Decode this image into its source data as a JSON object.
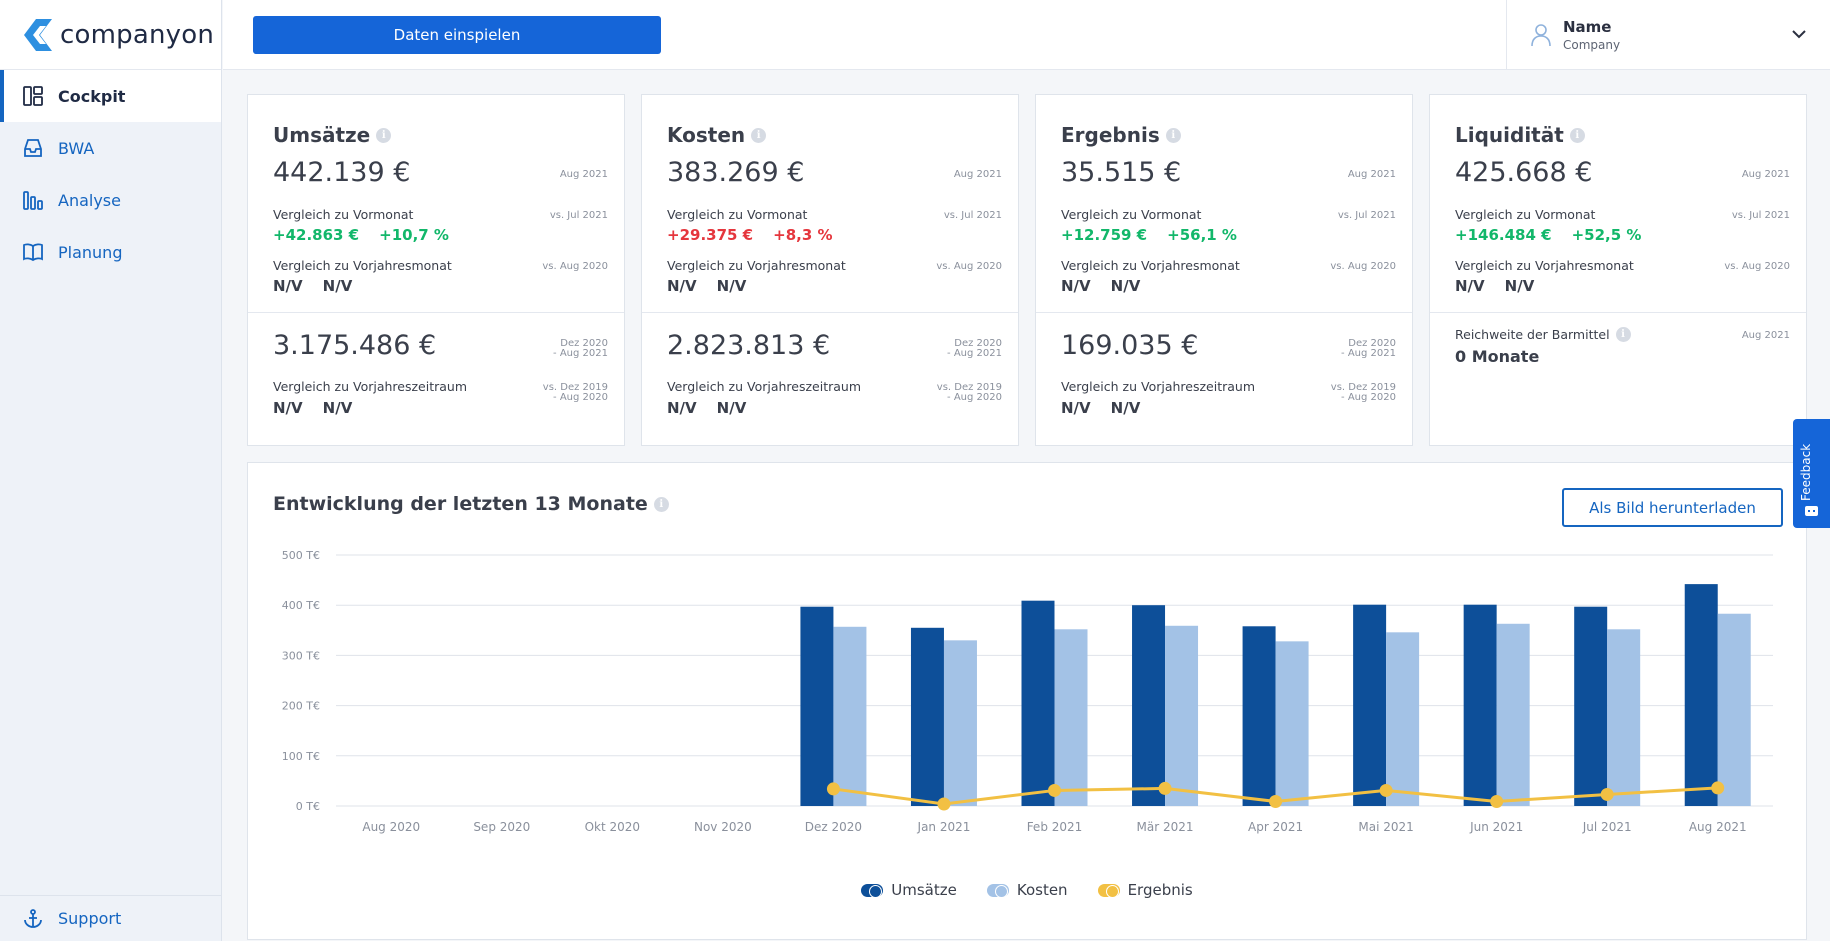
{
  "app": {
    "logo_text": "companyon"
  },
  "sidebar": {
    "items": [
      {
        "label": "Cockpit",
        "icon": "dashboard-icon",
        "active": true
      },
      {
        "label": "BWA",
        "icon": "inbox-icon",
        "active": false
      },
      {
        "label": "Analyse",
        "icon": "bar-chart-icon",
        "active": false
      },
      {
        "label": "Planung",
        "icon": "book-icon",
        "active": false
      }
    ],
    "support_label": "Support"
  },
  "topbar": {
    "import_button": "Daten einspielen",
    "user_name": "Name",
    "user_company": "Company"
  },
  "cards": [
    {
      "title": "Umsätze",
      "value": "442.139 €",
      "date": "Aug 2021",
      "vm_label": "Vergleich zu Vormonat",
      "vm_date": "vs. Jul 2021",
      "vm_abs": "+42.863 €",
      "vm_pct": "+10,7 %",
      "vm_status": "pos",
      "vj_label": "Vergleich zu Vorjahresmonat",
      "vj_date": "vs. Aug 2020",
      "vj_abs": "N/V",
      "vj_pct": "N/V",
      "range_value": "3.175.486 €",
      "range_date1": "Dez 2020",
      "range_date2": "- Aug 2021",
      "vz_label": "Vergleich zu Vorjahreszeitraum",
      "vz_date1": "vs. Dez 2019",
      "vz_date2": "- Aug 2020",
      "vz_abs": "N/V",
      "vz_pct": "N/V"
    },
    {
      "title": "Kosten",
      "value": "383.269 €",
      "date": "Aug 2021",
      "vm_label": "Vergleich zu Vormonat",
      "vm_date": "vs. Jul 2021",
      "vm_abs": "+29.375 €",
      "vm_pct": "+8,3 %",
      "vm_status": "neg",
      "vj_label": "Vergleich zu Vorjahresmonat",
      "vj_date": "vs. Aug 2020",
      "vj_abs": "N/V",
      "vj_pct": "N/V",
      "range_value": "2.823.813 €",
      "range_date1": "Dez 2020",
      "range_date2": "- Aug 2021",
      "vz_label": "Vergleich zu Vorjahreszeitraum",
      "vz_date1": "vs. Dez 2019",
      "vz_date2": "- Aug 2020",
      "vz_abs": "N/V",
      "vz_pct": "N/V"
    },
    {
      "title": "Ergebnis",
      "value": "35.515 €",
      "date": "Aug 2021",
      "vm_label": "Vergleich zu Vormonat",
      "vm_date": "vs. Jul 2021",
      "vm_abs": "+12.759 €",
      "vm_pct": "+56,1 %",
      "vm_status": "pos",
      "vj_label": "Vergleich zu Vorjahresmonat",
      "vj_date": "vs. Aug 2020",
      "vj_abs": "N/V",
      "vj_pct": "N/V",
      "range_value": "169.035 €",
      "range_date1": "Dez 2020",
      "range_date2": "- Aug 2021",
      "vz_label": "Vergleich zu Vorjahreszeitraum",
      "vz_date1": "vs. Dez 2019",
      "vz_date2": "- Aug 2020",
      "vz_abs": "N/V",
      "vz_pct": "N/V"
    },
    {
      "title": "Liquidität",
      "value": "425.668 €",
      "date": "Aug 2021",
      "vm_label": "Vergleich zu Vormonat",
      "vm_date": "vs. Jul 2021",
      "vm_abs": "+146.484 €",
      "vm_pct": "+52,5 %",
      "vm_status": "pos",
      "vj_label": "Vergleich zu Vorjahresmonat",
      "vj_date": "vs. Aug 2020",
      "vj_abs": "N/V",
      "vj_pct": "N/V",
      "reichweite_label": "Reichweite der Barmittel",
      "reichweite_date": "Aug 2021",
      "reichweite_value": "0 Monate"
    }
  ],
  "chart_panel": {
    "title": "Entwicklung der letzten 13 Monate",
    "download_button": "Als Bild herunterladen"
  },
  "colors": {
    "umsaetze": "#0d4f99",
    "kosten": "#a3c2e6",
    "ergebnis": "#f2c043",
    "primary": "#1565d8",
    "positive": "#12b76a",
    "negative": "#e5363d"
  },
  "chart_data": {
    "type": "bar",
    "categories": [
      "Aug 2020",
      "Sep 2020",
      "Okt 2020",
      "Nov 2020",
      "Dez 2020",
      "Jan 2021",
      "Feb 2021",
      "Mär 2021",
      "Apr 2021",
      "Mai 2021",
      "Jun 2021",
      "Jul 2021",
      "Aug 2021"
    ],
    "series": [
      {
        "name": "Umsätze",
        "kind": "bar",
        "values": [
          null,
          null,
          null,
          null,
          397,
          355,
          409,
          400,
          358,
          401,
          401,
          397,
          442
        ]
      },
      {
        "name": "Kosten",
        "kind": "bar",
        "values": [
          null,
          null,
          null,
          null,
          357,
          330,
          352,
          359,
          328,
          346,
          363,
          352,
          383
        ]
      },
      {
        "name": "Ergebnis",
        "kind": "line",
        "values": [
          null,
          null,
          null,
          null,
          34,
          4,
          31,
          35,
          9,
          31,
          9,
          23,
          36
        ]
      }
    ],
    "yticks": [
      "0 T€",
      "100 T€",
      "200 T€",
      "300 T€",
      "400 T€",
      "500 T€"
    ],
    "ylim": [
      0,
      500
    ],
    "grid": true,
    "legend_position": "bottom-center"
  },
  "feedback_label": "Feedback"
}
